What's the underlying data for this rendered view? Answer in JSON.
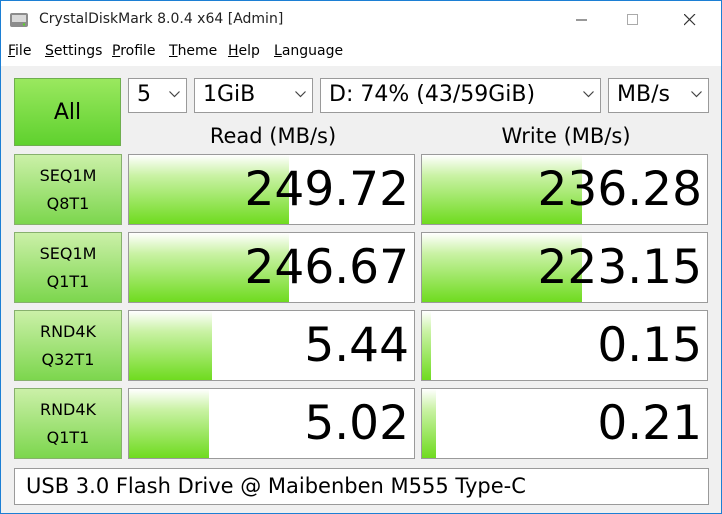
{
  "window": {
    "title": "CrystalDiskMark 8.0.4 x64 [Admin]"
  },
  "menu": {
    "items": [
      {
        "name": "file",
        "pre": "",
        "ul": "F",
        "post": "ile"
      },
      {
        "name": "settings",
        "pre": "",
        "ul": "S",
        "post": "ettings"
      },
      {
        "name": "profile",
        "pre": "",
        "ul": "P",
        "post": "rofile"
      },
      {
        "name": "theme",
        "pre": "",
        "ul": "T",
        "post": "heme"
      },
      {
        "name": "help",
        "pre": "",
        "ul": "H",
        "post": "elp"
      },
      {
        "name": "language",
        "pre": "",
        "ul": "L",
        "post": "anguage"
      }
    ]
  },
  "controls": {
    "all_label": "All",
    "count": "5",
    "size": "1GiB",
    "drive": "D: 74% (43/59GiB)",
    "unit": "MB/s"
  },
  "headers": {
    "read": "Read (MB/s)",
    "write": "Write (MB/s)"
  },
  "results": [
    {
      "line1": "SEQ1M",
      "line2": "Q8T1",
      "read": "249.72",
      "write": "236.28",
      "read_fill": 0.56,
      "write_fill": 0.56
    },
    {
      "line1": "SEQ1M",
      "line2": "Q1T1",
      "read": "246.67",
      "write": "223.15",
      "read_fill": 0.56,
      "write_fill": 0.56
    },
    {
      "line1": "RND4K",
      "line2": "Q32T1",
      "read": "5.44",
      "write": "0.15",
      "read_fill": 0.29,
      "write_fill": 0.03
    },
    {
      "line1": "RND4K",
      "line2": "Q1T1",
      "read": "5.02",
      "write": "0.21",
      "read_fill": 0.28,
      "write_fill": 0.05
    }
  ],
  "comment": "USB 3.0 Flash Drive @ Maibenben M555 Type-C",
  "colors": {
    "bar_green": "#6fdb1f",
    "button_green": "#7cd64d",
    "window_border": "#1c7fd4"
  }
}
